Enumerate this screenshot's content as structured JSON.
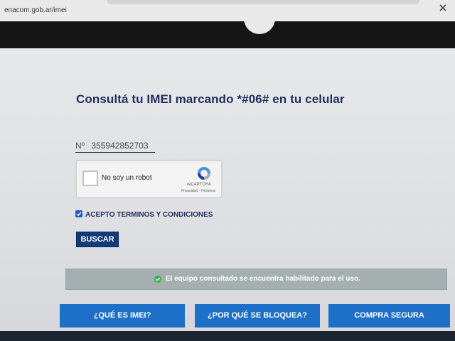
{
  "browser": {
    "url": "enacom.gob.ar/imei"
  },
  "page": {
    "title": "Consultá tu IMEI marcando *#06# en tu celular"
  },
  "form": {
    "imei_prefix": "Nº",
    "imei_value": "355942852703",
    "recaptcha": {
      "label": "No soy un robot",
      "brand": "reCAPTCHA",
      "links": "Privacidad - Términos"
    },
    "terms_label": "ACEPTO TERMINOS Y CONDICIONES",
    "terms_checked": true,
    "search_button": "BUSCAR"
  },
  "status": {
    "message": "El equipo consultado se encuentra habilitado para el uso.",
    "icon": "check-circle-icon",
    "color": "#2fb34a"
  },
  "nav": {
    "items": [
      {
        "label": "¿QUÉ ES IMEI?"
      },
      {
        "label": "¿POR QUÉ SE BLOQUEA?"
      },
      {
        "label": "COMPRA SEGURA"
      }
    ]
  },
  "colors": {
    "primary": "#123a7a",
    "nav": "#1d6fc8",
    "title": "#1f2f5a"
  }
}
